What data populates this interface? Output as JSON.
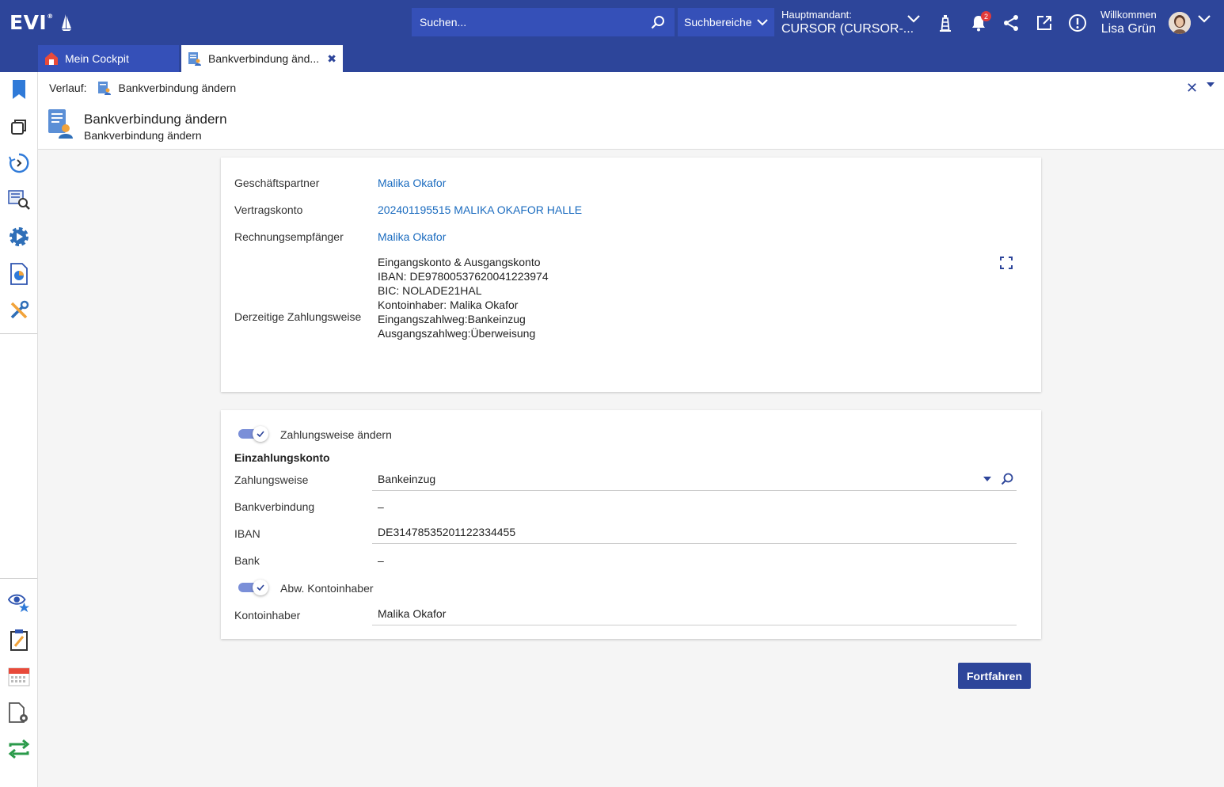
{
  "app": {
    "logo": "EVI",
    "logo_mark": "®"
  },
  "search": {
    "placeholder": "Suchen...",
    "scope_label": "Suchbereiche"
  },
  "tenant": {
    "label": "Hauptmandant:",
    "value": "CURSOR (CURSOR-..."
  },
  "notifications": {
    "count": "2"
  },
  "user": {
    "greeting": "Willkommen",
    "name": "Lisa Grün"
  },
  "tabs": [
    {
      "label": "Mein Cockpit"
    },
    {
      "label": "Bankverbindung änd...",
      "close": "✖"
    }
  ],
  "breadcrumb": {
    "label": "Verlauf:",
    "item": "Bankverbindung ändern"
  },
  "header": {
    "title": "Bankverbindung ändern",
    "subtitle": "Bankverbindung ändern"
  },
  "info": {
    "partner_label": "Geschäftspartner",
    "partner_value": "Malika Okafor",
    "contract_label": "Vertragskonto",
    "contract_value": "202401195515 MALIKA OKAFOR HALLE",
    "recipient_label": "Rechnungsempfänger",
    "recipient_value": "Malika Okafor",
    "payment_label": "Derzeitige Zahlungsweise",
    "payment_lines": [
      "Eingangskonto & Ausgangskonto",
      "IBAN: DE97800537620041223974",
      "BIC: NOLADE21HAL",
      "Kontoinhaber: Malika Okafor",
      "Eingangszahlweg:Bankeinzug",
      "Ausgangszahlweg:Überweisung"
    ]
  },
  "form": {
    "toggle_payment_label": "Zahlungsweise ändern",
    "section_title": "Einzahlungskonto",
    "method_label": "Zahlungsweise",
    "method_value": "Bankeinzug",
    "bank_connection_label": "Bankverbindung",
    "bank_connection_value": "–",
    "iban_label": "IBAN",
    "iban_value": "DE31478535201122334455",
    "bank_label": "Bank",
    "bank_value": "–",
    "toggle_holder_label": "Abw. Kontoinhaber",
    "holder_label": "Kontoinhaber",
    "holder_value": "Malika Okafor"
  },
  "actions": {
    "continue_label": "Fortfahren"
  },
  "colors": {
    "brand": "#2d459a",
    "link": "#1a6bbf",
    "toggle": "#7a8fd8"
  }
}
